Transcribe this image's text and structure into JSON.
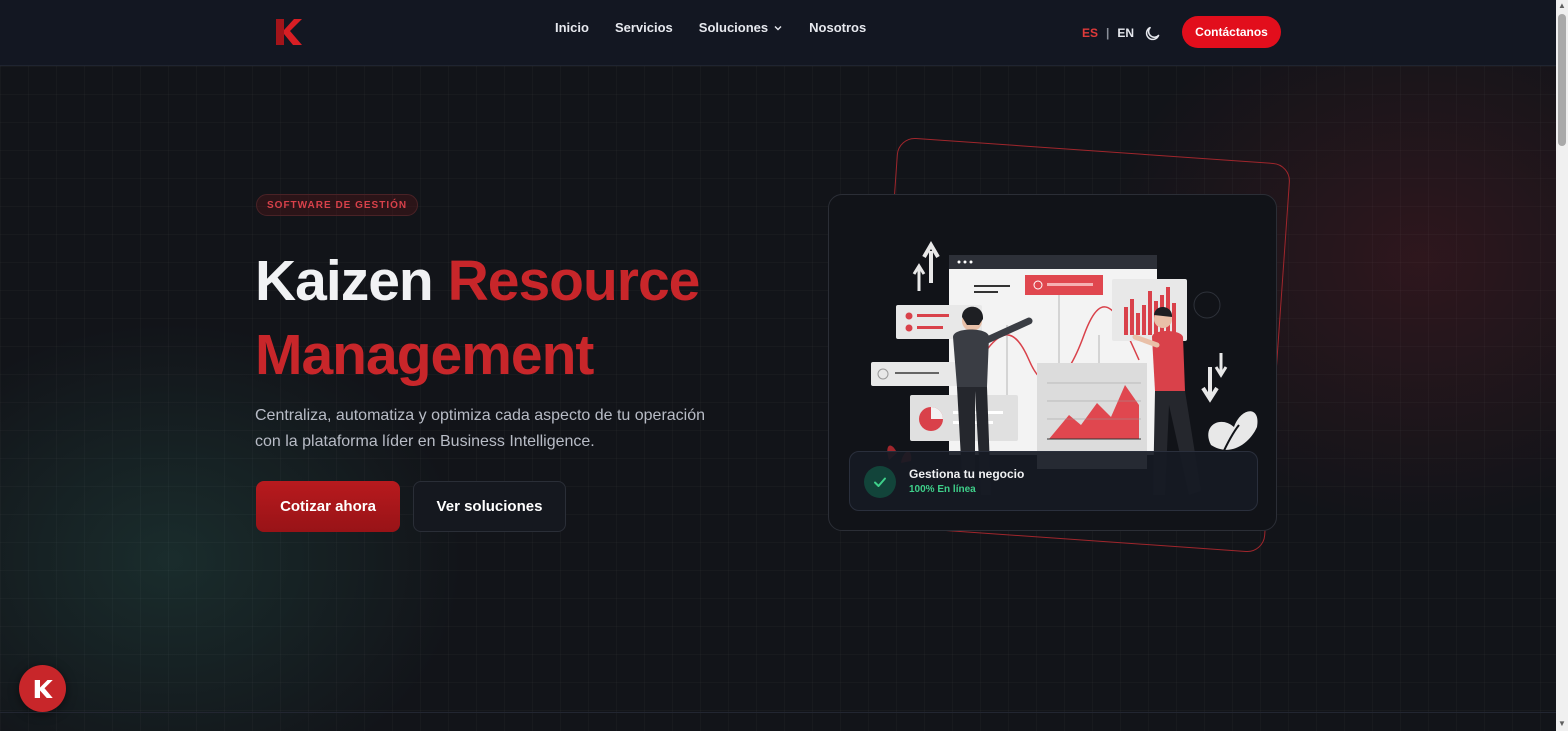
{
  "nav": {
    "logo_label": "K",
    "menu": [
      {
        "label": "Inicio"
      },
      {
        "label": "Servicios"
      },
      {
        "label": "Soluciones"
      },
      {
        "label": "Nosotros"
      }
    ],
    "lang_es": "ES",
    "lang_sep": "|",
    "lang_en": "EN",
    "theme_icon": "moon-icon",
    "contact_label": "Contáctanos"
  },
  "hero": {
    "badge": "SOFTWARE DE GESTIÓN",
    "title_white": "Kaizen",
    "title_red_1": "Resource",
    "title_red_2": "Management",
    "description": "Centraliza, automatiza y optimiza cada aspecto de tu operación con la plataforma líder en Business Intelligence.",
    "primary_button": "Cotizar ahora",
    "secondary_button": "Ver soluciones"
  },
  "status_card": {
    "title": "Gestiona tu negocio",
    "subtitle": "100% En línea",
    "icon": "check-icon"
  },
  "colors": {
    "accent": "#c8262a",
    "cta": "#e20e1c",
    "success": "#3ed08a",
    "background": "#121419"
  },
  "floating_button": {
    "icon": "kaizen-logo-icon"
  }
}
